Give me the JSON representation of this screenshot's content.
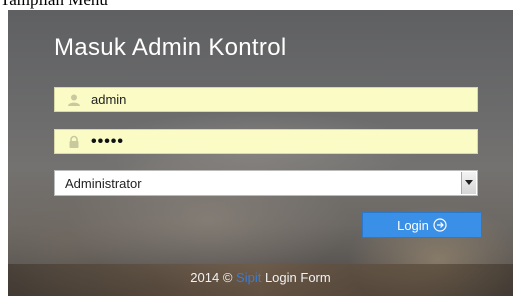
{
  "caption": "Tampilan Menu",
  "form": {
    "title": "Masuk Admin Kontrol",
    "username_value": "admin",
    "password_value": "•••••",
    "role_selected": "Administrator",
    "login_label": "Login"
  },
  "icons": {
    "username": "user-icon",
    "password": "lock-icon",
    "dropdown": "chevron-down-icon",
    "login": "arrow-right-circle-icon"
  },
  "colors": {
    "input_bg": "#fbfbc6",
    "button_bg": "#3a8fe6",
    "title_text": "#ffffff"
  },
  "footer": {
    "prefix": "2014 ©",
    "brand": "Sipit",
    "suffix": "Login Form"
  }
}
